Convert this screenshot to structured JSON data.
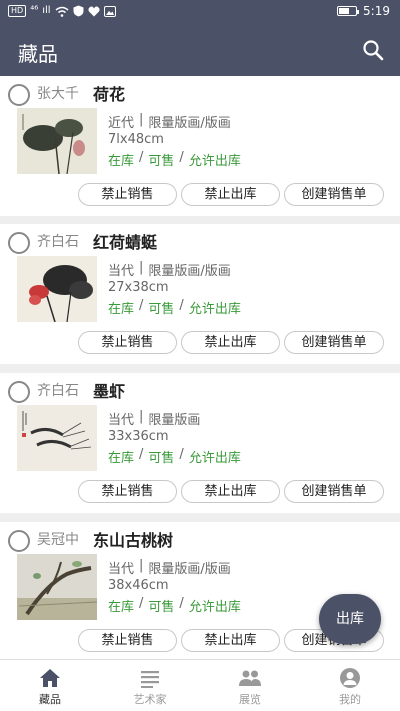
{
  "status_bar": {
    "left_indicators": [
      "HD",
      "⁴⁶",
      "ıll"
    ],
    "battery_level": 0.55,
    "time": "5:19"
  },
  "header": {
    "title": "藏品",
    "search_icon": "search-icon"
  },
  "items": [
    {
      "artist": "张大千",
      "title": "荷花",
      "period": "近代",
      "separator": "|",
      "type": "限量版画/版画",
      "size": "7lx48cm",
      "status": [
        "在库",
        "可售",
        "允许出库"
      ],
      "actions": [
        "禁止销售",
        "禁止出库",
        "创建销售单"
      ]
    },
    {
      "artist": "齐白石",
      "title": "红荷蜻蜓",
      "period": "当代",
      "separator": "|",
      "type": "限量版画/版画",
      "size": "27x38cm",
      "status": [
        "在库",
        "可售",
        "允许出库"
      ],
      "actions": [
        "禁止销售",
        "禁止出库",
        "创建销售单"
      ]
    },
    {
      "artist": "齐白石",
      "title": "墨虾",
      "period": "当代",
      "separator": "|",
      "type": "限量版画",
      "size": "33x36cm",
      "status": [
        "在库",
        "可售",
        "允许出库"
      ],
      "actions": [
        "禁止销售",
        "禁止出库",
        "创建销售单"
      ]
    },
    {
      "artist": "吴冠中",
      "title": "东山古桃树",
      "period": "当代",
      "separator": "|",
      "type": "限量版画/版画",
      "size": "38x46cm",
      "status": [
        "在库",
        "可售",
        "允许出库"
      ],
      "actions": [
        "禁止销售",
        "禁止出库",
        "创建销售单"
      ]
    }
  ],
  "status_separator": "/",
  "fab": {
    "label": "出库"
  },
  "bottom_nav": [
    {
      "label": "藏品",
      "icon": "home-icon",
      "active": true
    },
    {
      "label": "艺术家",
      "icon": "list-icon",
      "active": false
    },
    {
      "label": "展览",
      "icon": "people-icon",
      "active": false
    },
    {
      "label": "我的",
      "icon": "profile-icon",
      "active": false
    }
  ],
  "colors": {
    "primary": "#4b5166",
    "status_green": "#3a9a3a",
    "background": "#eeeeee"
  }
}
